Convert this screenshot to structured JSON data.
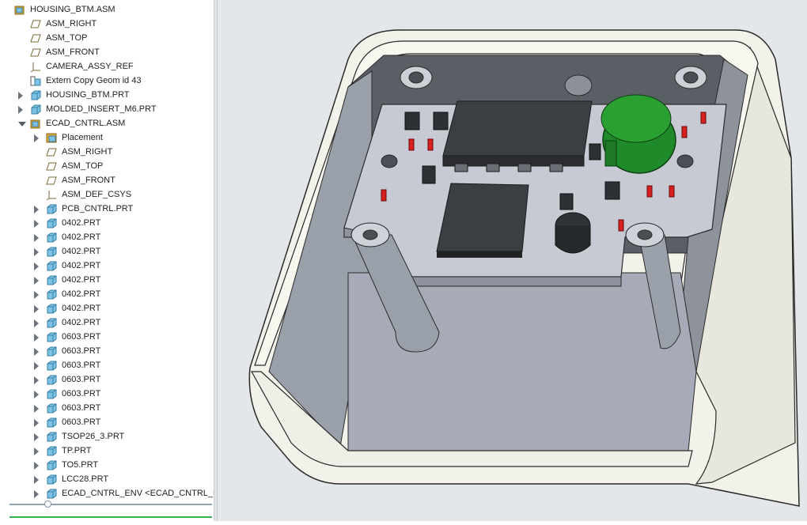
{
  "model_tree": {
    "items": [
      {
        "label": "HOUSING_BTM.ASM",
        "icon": "assembly-icon",
        "arrow": "none",
        "level": 0
      },
      {
        "label": "ASM_RIGHT",
        "icon": "datum-plane-icon",
        "arrow": "none",
        "level": 1
      },
      {
        "label": "ASM_TOP",
        "icon": "datum-plane-icon",
        "arrow": "none",
        "level": 1
      },
      {
        "label": "ASM_FRONT",
        "icon": "datum-plane-icon",
        "arrow": "none",
        "level": 1
      },
      {
        "label": "CAMERA_ASSY_REF",
        "icon": "coordinate-system-icon",
        "arrow": "none",
        "level": 1
      },
      {
        "label": "Extern Copy Geom id 43",
        "icon": "external-copy-geom-icon",
        "arrow": "none",
        "level": 1
      },
      {
        "label": "HOUSING_BTM.PRT",
        "icon": "part-icon",
        "arrow": "collapsed",
        "level": 1
      },
      {
        "label": "MOLDED_INSERT_M6.PRT",
        "icon": "part-icon",
        "arrow": "collapsed",
        "level": 1
      },
      {
        "label": "ECAD_CNTRL.ASM",
        "icon": "assembly-icon",
        "arrow": "expanded",
        "level": 1
      },
      {
        "label": "Placement",
        "icon": "placement-icon",
        "arrow": "collapsed",
        "level": 2
      },
      {
        "label": "ASM_RIGHT",
        "icon": "datum-plane-icon",
        "arrow": "none",
        "level": 2
      },
      {
        "label": "ASM_TOP",
        "icon": "datum-plane-icon",
        "arrow": "none",
        "level": 2
      },
      {
        "label": "ASM_FRONT",
        "icon": "datum-plane-icon",
        "arrow": "none",
        "level": 2
      },
      {
        "label": "ASM_DEF_CSYS",
        "icon": "coordinate-system-icon",
        "arrow": "none",
        "level": 2
      },
      {
        "label": "PCB_CNTRL.PRT",
        "icon": "part-icon",
        "arrow": "collapsed",
        "level": 2
      },
      {
        "label": "0402.PRT",
        "icon": "part-icon",
        "arrow": "collapsed",
        "level": 2
      },
      {
        "label": "0402.PRT",
        "icon": "part-icon",
        "arrow": "collapsed",
        "level": 2
      },
      {
        "label": "0402.PRT",
        "icon": "part-icon",
        "arrow": "collapsed",
        "level": 2
      },
      {
        "label": "0402.PRT",
        "icon": "part-icon",
        "arrow": "collapsed",
        "level": 2
      },
      {
        "label": "0402.PRT",
        "icon": "part-icon",
        "arrow": "collapsed",
        "level": 2
      },
      {
        "label": "0402.PRT",
        "icon": "part-icon",
        "arrow": "collapsed",
        "level": 2
      },
      {
        "label": "0402.PRT",
        "icon": "part-icon",
        "arrow": "collapsed",
        "level": 2
      },
      {
        "label": "0402.PRT",
        "icon": "part-icon",
        "arrow": "collapsed",
        "level": 2
      },
      {
        "label": "0603.PRT",
        "icon": "part-icon",
        "arrow": "collapsed",
        "level": 2
      },
      {
        "label": "0603.PRT",
        "icon": "part-icon",
        "arrow": "collapsed",
        "level": 2
      },
      {
        "label": "0603.PRT",
        "icon": "part-icon",
        "arrow": "collapsed",
        "level": 2
      },
      {
        "label": "0603.PRT",
        "icon": "part-icon",
        "arrow": "collapsed",
        "level": 2
      },
      {
        "label": "0603.PRT",
        "icon": "part-icon",
        "arrow": "collapsed",
        "level": 2
      },
      {
        "label": "0603.PRT",
        "icon": "part-icon",
        "arrow": "collapsed",
        "level": 2
      },
      {
        "label": "0603.PRT",
        "icon": "part-icon",
        "arrow": "collapsed",
        "level": 2
      },
      {
        "label": "TSOP26_3.PRT",
        "icon": "part-icon",
        "arrow": "collapsed",
        "level": 2
      },
      {
        "label": "TP.PRT",
        "icon": "part-icon",
        "arrow": "collapsed",
        "level": 2
      },
      {
        "label": "TO5.PRT",
        "icon": "part-icon",
        "arrow": "collapsed",
        "level": 2
      },
      {
        "label": "LCC28.PRT",
        "icon": "part-icon",
        "arrow": "collapsed",
        "level": 2
      },
      {
        "label": "ECAD_CNTRL_ENV <ECAD_CNTRL_EN\\",
        "icon": "part-icon",
        "arrow": "collapsed",
        "level": 2
      }
    ]
  },
  "viewport": {
    "model": "3d-housing-with-pcb",
    "colors": {
      "housing": "#f2f1e9",
      "pcb": "#c6cad3",
      "chip": "#3a3d41",
      "buzzer": "#1f8a2a",
      "led": "#d92020",
      "floor": "#a8acb8"
    }
  },
  "progress": {
    "color": "#37b24d"
  }
}
